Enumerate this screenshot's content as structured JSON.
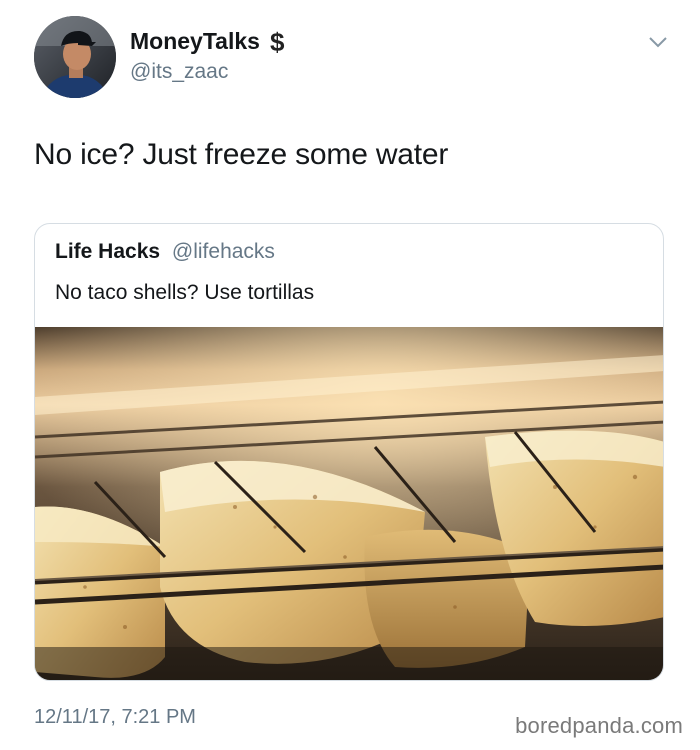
{
  "tweet": {
    "author": {
      "display_name": "MoneyTalks",
      "badge_icon": "dollar-sign-icon",
      "badge_glyph": "$",
      "handle": "@its_zaac"
    },
    "text": "No ice? Just freeze some water",
    "timestamp": "12/11/17, 7:21 PM"
  },
  "quoted_tweet": {
    "display_name": "Life Hacks",
    "handle": "@lifehacks",
    "text": "No taco shells? Use tortillas"
  },
  "watermark": "boredpanda.com"
}
